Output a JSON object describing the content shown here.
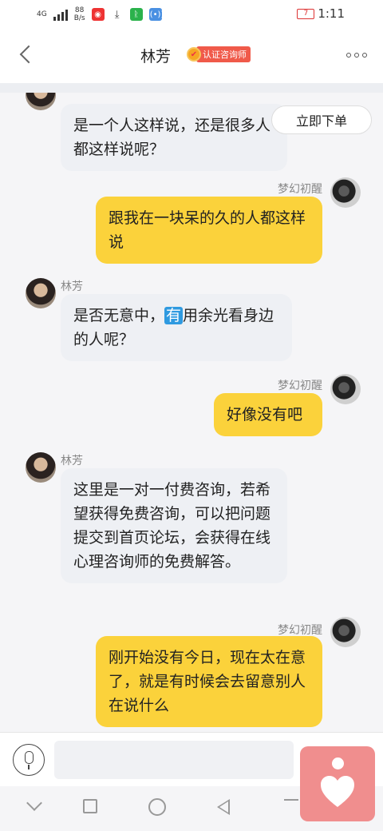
{
  "status_bar": {
    "signal": "4G",
    "network_speed": "88\nB/s",
    "battery": "7",
    "time": "1:11",
    "icons": [
      "weibo-icon",
      "download-icon",
      "fitness-icon",
      "nfc-icon"
    ]
  },
  "header": {
    "title": "林芳",
    "badge": "认证咨询师"
  },
  "order_button": "立即下单",
  "messages": [
    {
      "side": "left",
      "sender": "",
      "text": "是一个人这样说，还是很多人都这样说呢？"
    },
    {
      "side": "right",
      "sender": "梦幻初醒",
      "text": "跟我在一块呆的久的人都这样说"
    },
    {
      "side": "left",
      "sender": "林芳",
      "text_before": "是否无意中，",
      "highlight": "有",
      "text_after": "用余光看身边的人呢？"
    },
    {
      "side": "right",
      "sender": "梦幻初醒",
      "text": "好像没有吧"
    },
    {
      "side": "left",
      "sender": "林芳",
      "text": "这里是一对一付费咨询，若希望获得免费咨询，可以把问题提交到首页论坛，会获得在线心理咨询师的免费解答。"
    },
    {
      "side": "right",
      "sender": "梦幻初醒",
      "text": "刚开始没有今日，现在太在意了，就是有时候会去留意别人在说什么"
    }
  ],
  "input": {
    "value": "",
    "placeholder": ""
  },
  "colors": {
    "self_bubble": "#fbd23b",
    "other_bubble": "#eef0f4",
    "badge": "#f05a4a",
    "fab": "#f08e8e"
  }
}
